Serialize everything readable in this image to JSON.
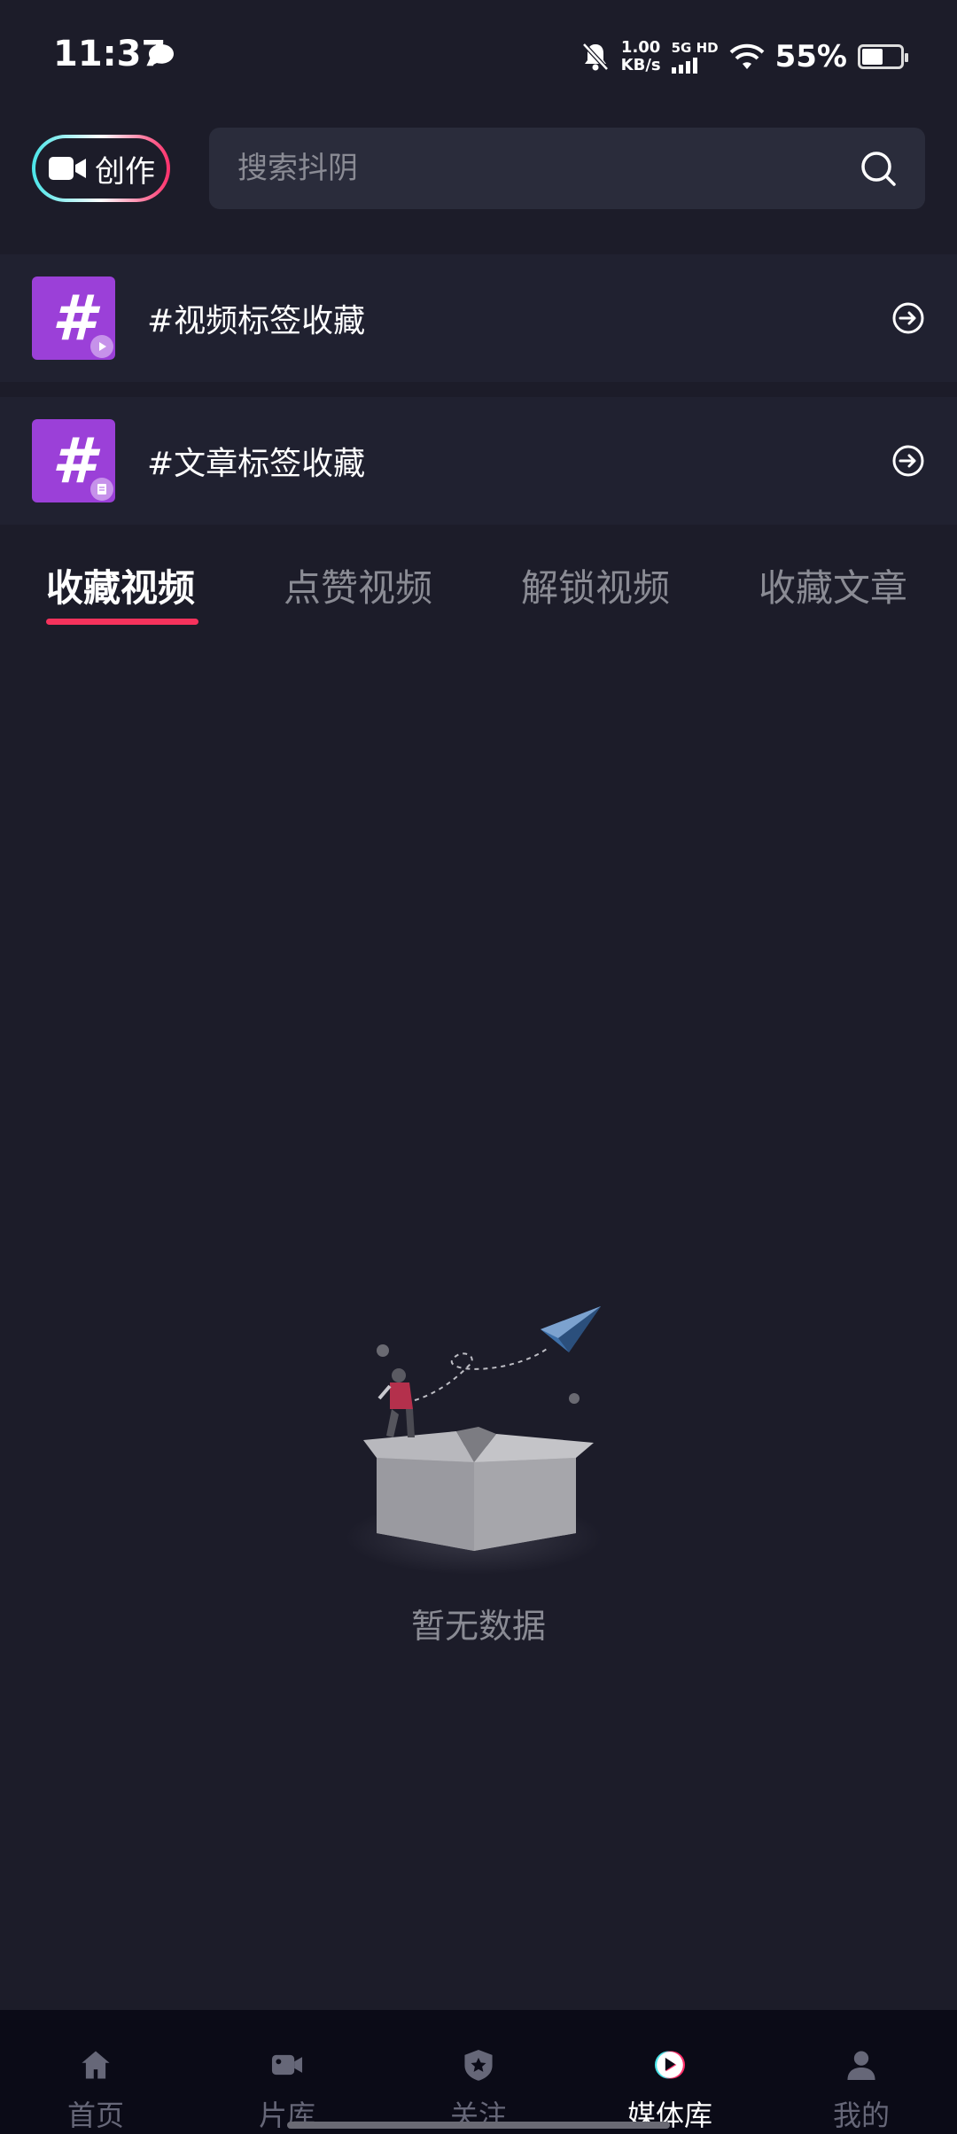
{
  "status_bar": {
    "time": "11:37",
    "net_speed_value": "1.00",
    "net_speed_unit": "KB/s",
    "network": "5G HD",
    "battery_percent": "55%",
    "battery_level": 0.55
  },
  "header": {
    "create_label": "创作",
    "search_placeholder": "搜索抖阴"
  },
  "tag_collections": [
    {
      "label": "#视频标签收藏",
      "badge_icon": "play-badge-icon"
    },
    {
      "label": "#文章标签收藏",
      "badge_icon": "article-badge-icon"
    }
  ],
  "tabs": [
    {
      "label": "收藏视频",
      "active": true
    },
    {
      "label": "点赞视频",
      "active": false
    },
    {
      "label": "解锁视频",
      "active": false
    },
    {
      "label": "收藏文章",
      "active": false
    }
  ],
  "empty_state": {
    "text": "暂无数据"
  },
  "bottom_nav": [
    {
      "label": "首页",
      "icon": "home-icon",
      "active": false
    },
    {
      "label": "片库",
      "icon": "video-camera-icon",
      "active": false
    },
    {
      "label": "关注",
      "icon": "shield-star-icon",
      "active": false
    },
    {
      "label": "媒体库",
      "icon": "media-library-icon",
      "active": true
    },
    {
      "label": "我的",
      "icon": "user-icon",
      "active": false
    }
  ],
  "colors": {
    "background": "#1c1c29",
    "accent_pink": "#f5325c",
    "tag_purple": "#9b40d8",
    "nav_background": "#0b0b17"
  }
}
